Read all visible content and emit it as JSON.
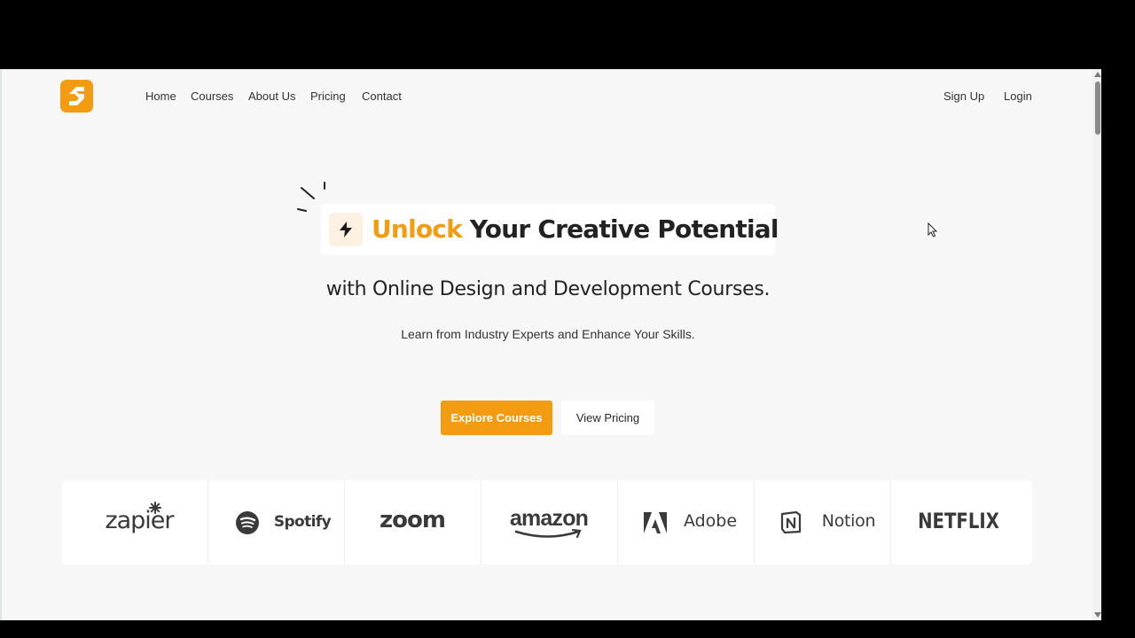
{
  "nav": {
    "logo_name": "brand-logo",
    "links": [
      {
        "label": "Home"
      },
      {
        "label": "Courses"
      },
      {
        "label": "About Us"
      },
      {
        "label": "Pricing"
      },
      {
        "label": "Contact"
      }
    ],
    "signup_label": "Sign Up",
    "login_label": "Login"
  },
  "hero": {
    "headline_accent": "Unlock",
    "headline_rest": " Your Creative Potential",
    "subheadline": "with Online Design and Development Courses.",
    "tagline": "Learn from Industry Experts and Enhance Your Skills.",
    "primary_cta": "Explore Courses",
    "secondary_cta": "View Pricing"
  },
  "brands": [
    {
      "name": "zapier",
      "icon": "zapier-asterisk-icon"
    },
    {
      "name": "Spotify",
      "icon": "spotify-icon"
    },
    {
      "name": "zoom",
      "icon": "zoom-wordmark"
    },
    {
      "name": "amazon",
      "icon": "amazon-smile-icon"
    },
    {
      "name": "Adobe",
      "icon": "adobe-icon"
    },
    {
      "name": "Notion",
      "icon": "notion-icon"
    },
    {
      "name": "NETFLIX",
      "icon": "netflix-wordmark"
    }
  ],
  "colors": {
    "accent": "#f39c12",
    "background": "#f7f7f7",
    "text": "#222222"
  }
}
